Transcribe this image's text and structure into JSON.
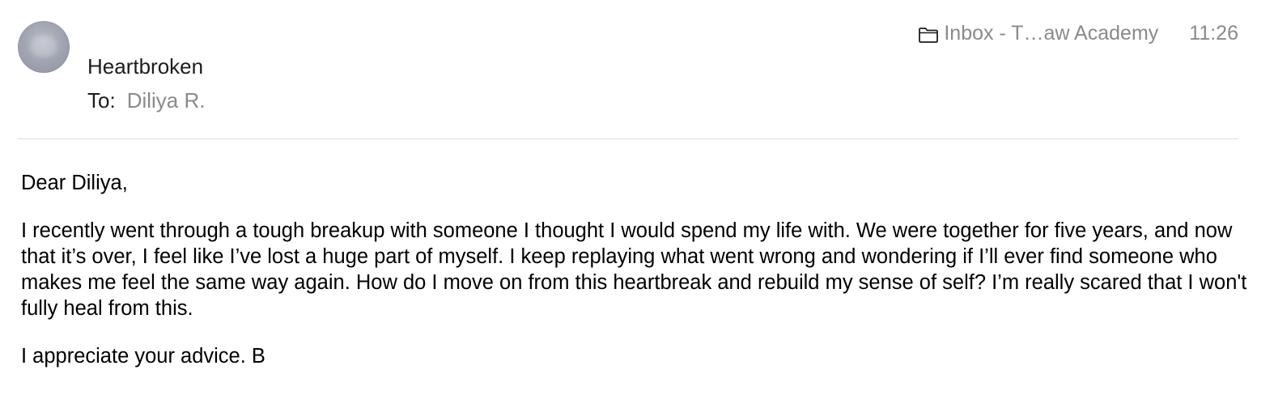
{
  "header": {
    "subject": "Heartbroken",
    "to_label": "To:",
    "to_value": "Diliya R.",
    "mailbox": "Inbox - T…aw Academy",
    "time": "11:26",
    "avatar_icon": "contact-avatar",
    "folder_icon": "folder-icon"
  },
  "message": {
    "greeting": "Dear Diliya,",
    "paragraph": "I recently went through a tough breakup with someone I thought I would spend my life with. We were together for five years, and now that it’s over, I feel like I’ve lost a huge part of myself. I keep replaying what went wrong and wondering if I’ll ever find someone who makes me feel the same way again. How do I move on from this heartbreak and rebuild my sense of self? I’m really scared that I won't fully heal from this.",
    "closing": "I appreciate your advice. B"
  },
  "colors": {
    "secondary_text": "#8a8a8e",
    "divider": "#dcdcdc"
  }
}
